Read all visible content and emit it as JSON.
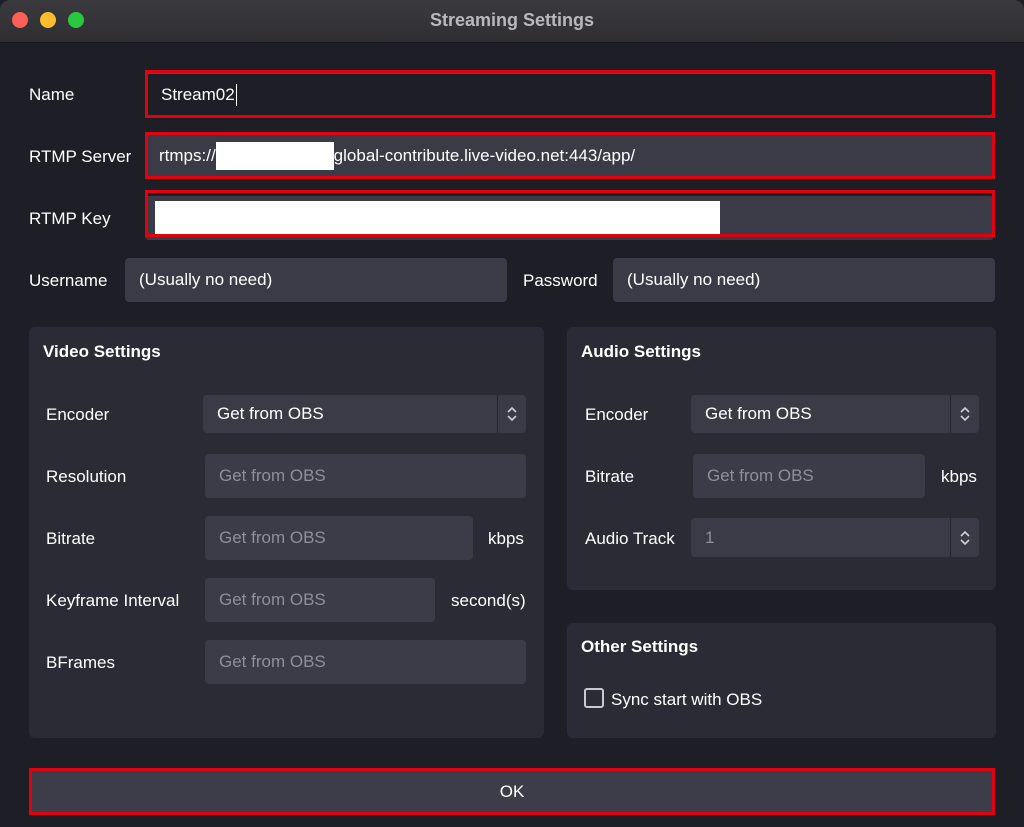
{
  "window": {
    "title": "Streaming Settings"
  },
  "form": {
    "name_label": "Name",
    "name_value": "Stream02",
    "rtmp_server_label": "RTMP Server",
    "rtmp_server_prefix": "rtmps://",
    "rtmp_server_suffix": "global-contribute.live-video.net:443/app/",
    "rtmp_key_label": "RTMP Key",
    "username_label": "Username",
    "username_placeholder": "(Usually no need)",
    "password_label": "Password",
    "password_placeholder": "(Usually no need)"
  },
  "video": {
    "title": "Video Settings",
    "encoder_label": "Encoder",
    "encoder_value": "Get from OBS",
    "resolution_label": "Resolution",
    "resolution_placeholder": "Get from OBS",
    "bitrate_label": "Bitrate",
    "bitrate_placeholder": "Get from OBS",
    "bitrate_unit": "kbps",
    "keyframe_label": "Keyframe Interval",
    "keyframe_placeholder": "Get from OBS",
    "keyframe_unit": "second(s)",
    "bframes_label": "BFrames",
    "bframes_placeholder": "Get from OBS"
  },
  "audio": {
    "title": "Audio Settings",
    "encoder_label": "Encoder",
    "encoder_value": "Get from OBS",
    "bitrate_label": "Bitrate",
    "bitrate_placeholder": "Get from OBS",
    "bitrate_unit": "kbps",
    "track_label": "Audio Track",
    "track_value": "1"
  },
  "other": {
    "title": "Other Settings",
    "sync_label": "Sync start with OBS",
    "sync_checked": false
  },
  "ok_label": "OK",
  "colors": {
    "highlight": "#e3000f",
    "field_bg": "#3a3b46",
    "panel_bg": "#2a2b34"
  }
}
